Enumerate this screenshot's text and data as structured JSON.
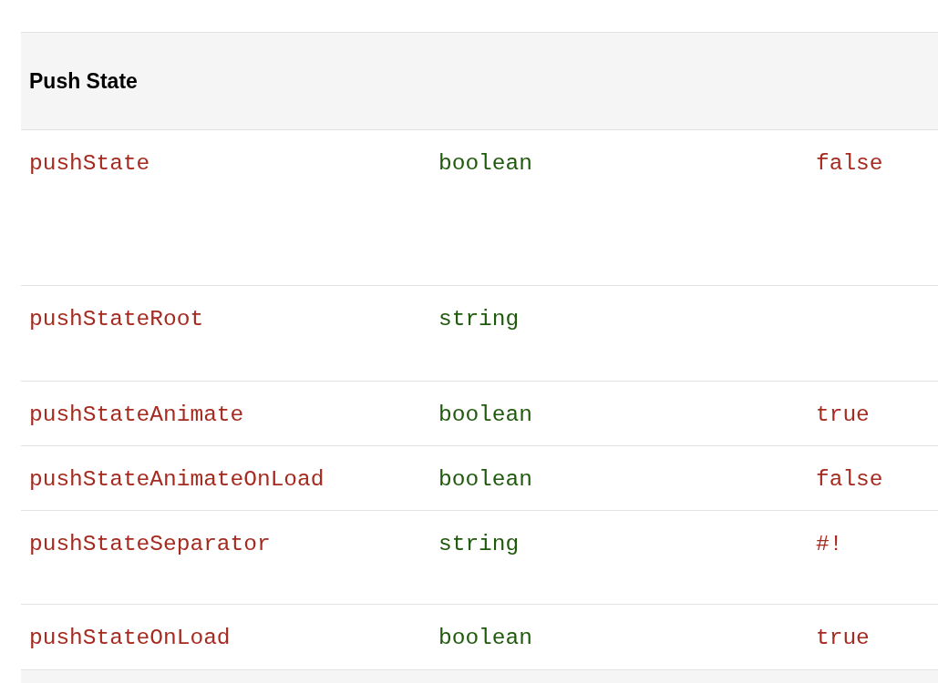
{
  "table": {
    "heading": "Push State",
    "rows": [
      {
        "name": "pushState",
        "type": "boolean",
        "default": "false"
      },
      {
        "name": "pushStateRoot",
        "type": "string",
        "default": ""
      },
      {
        "name": "pushStateAnimate",
        "type": "boolean",
        "default": "true"
      },
      {
        "name": "pushStateAnimateOnLoad",
        "type": "boolean",
        "default": "false"
      },
      {
        "name": "pushStateSeparator",
        "type": "string",
        "default": "#!"
      },
      {
        "name": "pushStateOnLoad",
        "type": "boolean",
        "default": "true"
      }
    ]
  }
}
